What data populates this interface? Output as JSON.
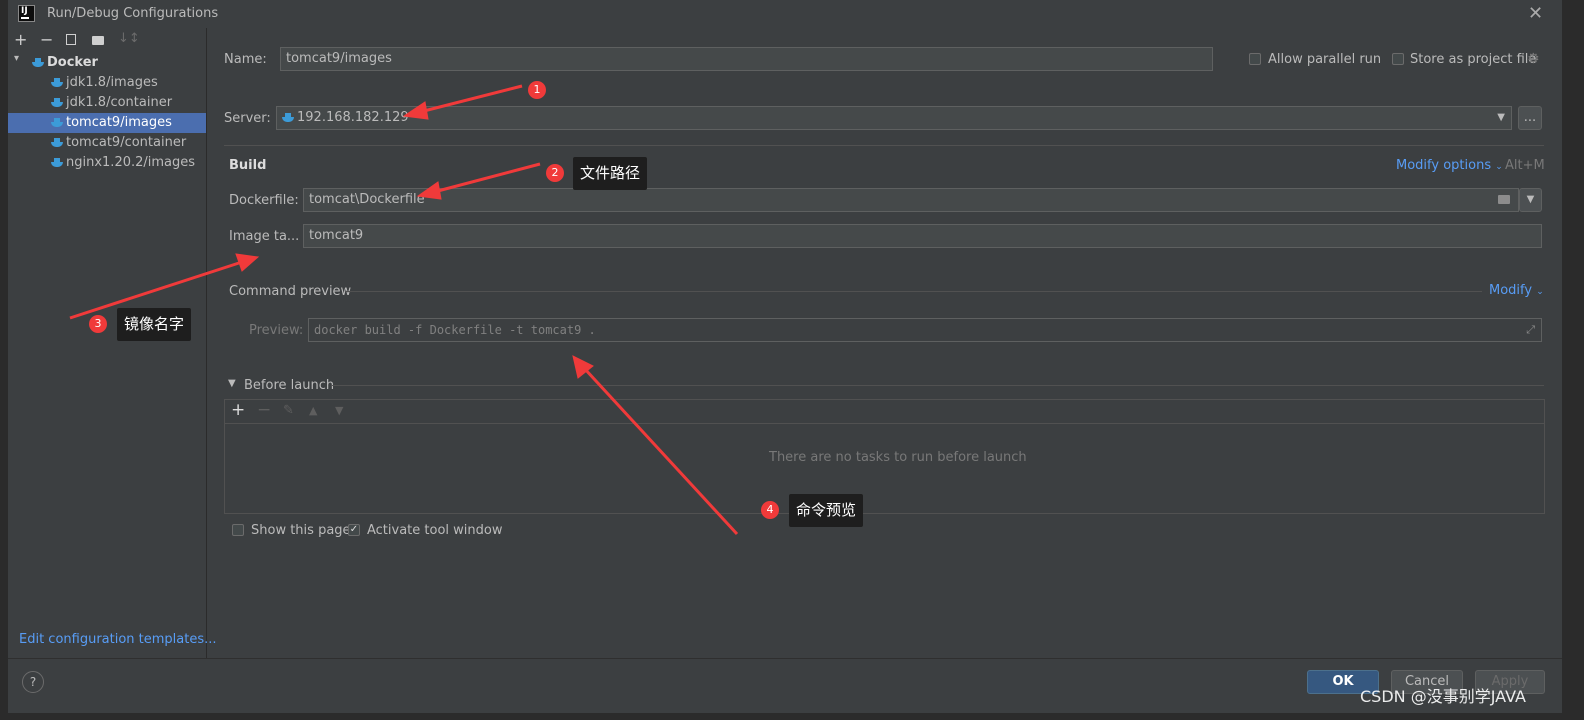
{
  "window": {
    "title": "Run/Debug Configurations"
  },
  "tree": {
    "group": "Docker",
    "items": [
      {
        "label": "jdk1.8/images"
      },
      {
        "label": "jdk1.8/container"
      },
      {
        "label": "tomcat9/images",
        "selected": true
      },
      {
        "label": "tomcat9/container"
      },
      {
        "label": "nginx1.20.2/images"
      }
    ],
    "edit_templates": "Edit configuration templates..."
  },
  "form": {
    "name_label": "Name:",
    "name_value": "tomcat9/images",
    "allow_parallel": "Allow parallel run",
    "store_project": "Store as project file",
    "server_label": "Server:",
    "server_value": "192.168.182.129",
    "server_more": "...",
    "build_header": "Build",
    "modify_options": "Modify options",
    "modify_shortcut": "Alt+M",
    "dockerfile_label": "Dockerfile:",
    "dockerfile_value": "tomcat\\Dockerfile",
    "image_tag_label": "Image ta...",
    "image_tag_value": "tomcat9",
    "command_preview_header": "Command preview",
    "modify_link": "Modify",
    "preview_label": "Preview:",
    "preview_value": "docker build -f Dockerfile -t tomcat9 .",
    "before_launch_header": "Before launch",
    "no_tasks": "There are no tasks to run before launch",
    "show_page": "Show this page",
    "activate_tool_window": "Activate tool window"
  },
  "buttons": {
    "ok": "OK",
    "cancel": "Cancel",
    "apply": "Apply",
    "help": "?"
  },
  "annotations": [
    {
      "num": "1",
      "text": ""
    },
    {
      "num": "2",
      "text": "文件路径"
    },
    {
      "num": "3",
      "text": "镜像名字"
    },
    {
      "num": "4",
      "text": "命令预览"
    }
  ],
  "watermark": "CSDN @没事别学JAVA",
  "colors": {
    "accent": "#4b6eaf",
    "link": "#589df6",
    "annotation_red": "#f03a3a"
  }
}
